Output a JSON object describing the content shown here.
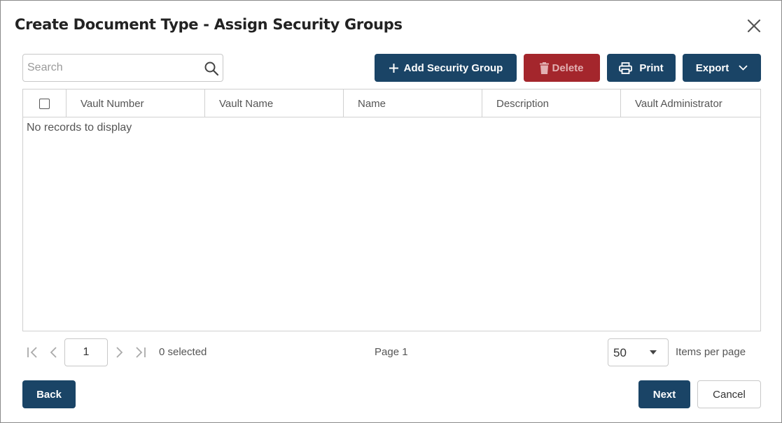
{
  "dialog": {
    "title": "Create Document Type - Assign Security Groups"
  },
  "search": {
    "placeholder": "Search"
  },
  "toolbar": {
    "add_label": "Add Security Group",
    "delete_label": "Delete",
    "print_label": "Print",
    "export_label": "Export"
  },
  "grid": {
    "columns": [
      "Vault Number",
      "Vault Name",
      "Name",
      "Description",
      "Vault Administrator"
    ],
    "empty_message": "No records to display"
  },
  "pager": {
    "current_page": "1",
    "selected_text": "0 selected",
    "page_text": "Page 1",
    "page_size": "50",
    "items_per_page_label": "Items per page"
  },
  "footer": {
    "back_label": "Back",
    "next_label": "Next",
    "cancel_label": "Cancel"
  },
  "colors": {
    "primary": "#1a4466",
    "danger": "#a4262c"
  }
}
